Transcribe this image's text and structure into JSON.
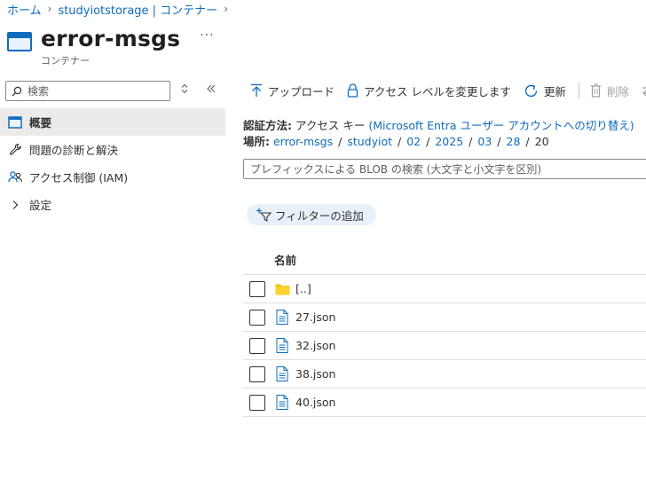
{
  "breadcrumb": {
    "home": "ホーム",
    "storage": "studyiotstorage | コンテナー"
  },
  "header": {
    "title": "error-msgs",
    "subtitle": "コンテナー",
    "more": "···"
  },
  "sidebar": {
    "search_placeholder": "検索",
    "items": [
      {
        "label": "概要",
        "icon": "overview-icon",
        "active": true
      },
      {
        "label": "問題の診断と解決",
        "icon": "wrench-icon"
      },
      {
        "label": "アクセス制御 (IAM)",
        "icon": "people-icon"
      },
      {
        "label": "設定",
        "icon": "chevron-right-icon"
      }
    ]
  },
  "toolbar": {
    "upload": "アップロード",
    "access_level": "アクセス レベルを変更します",
    "refresh": "更新",
    "delete": "削除"
  },
  "auth": {
    "label": "認証方法:",
    "method": "アクセス キー",
    "switch_link": "(Microsoft Entra ユーザー アカウントへの切り替え)"
  },
  "location": {
    "label": "場所:",
    "parts": [
      "error-msgs",
      "studyiot",
      "02",
      "2025",
      "03",
      "28"
    ],
    "current": "20"
  },
  "prefix_search_placeholder": "プレフィックスによる BLOB の検索 (大文字と小文字を区別)",
  "filter_button": "フィルターの追加",
  "table": {
    "column_name": "名前",
    "rows": [
      {
        "name": "[..]",
        "type": "folder"
      },
      {
        "name": "27.json",
        "type": "file"
      },
      {
        "name": "32.json",
        "type": "file"
      },
      {
        "name": "38.json",
        "type": "file"
      },
      {
        "name": "40.json",
        "type": "file"
      }
    ]
  },
  "colors": {
    "accent": "#0f6cbd",
    "folder": "#f5c400",
    "active_bg": "#edebe9"
  }
}
